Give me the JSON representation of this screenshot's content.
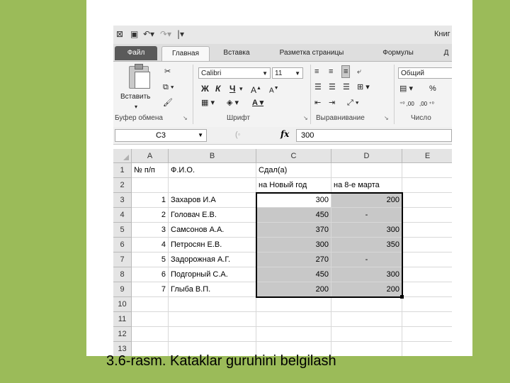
{
  "window": {
    "title": "Книг"
  },
  "tabs": [
    {
      "label": "Файл"
    },
    {
      "label": "Главная"
    },
    {
      "label": "Вставка"
    },
    {
      "label": "Разметка страницы"
    },
    {
      "label": "Формулы"
    },
    {
      "label": "Д"
    }
  ],
  "ribbon": {
    "clipboard": {
      "paste_label": "Вставить",
      "group_label": "Буфер обмена"
    },
    "font": {
      "name": "Calibri",
      "size": "11",
      "group_label": "Шрифт",
      "bold": "Ж",
      "italic": "К",
      "underline": "Ч"
    },
    "alignment": {
      "group_label": "Выравнивание"
    },
    "number": {
      "format": "Общий",
      "group_label": "Число",
      "percent": "%"
    }
  },
  "formula_bar": {
    "name_box": "C3",
    "fx": "fx",
    "value": "300"
  },
  "sheet": {
    "columns": [
      "A",
      "B",
      "C",
      "D",
      "E"
    ],
    "rows": [
      {
        "n": "1",
        "a": "№ п/п",
        "b": "Ф.И.О.",
        "c": "Сдал(а)",
        "d": ""
      },
      {
        "n": "2",
        "a": "",
        "b": "",
        "c": "на Новый год",
        "d": "на 8-е марта"
      },
      {
        "n": "3",
        "a": "1",
        "b": "Захаров И.А",
        "c": "300",
        "d": "200"
      },
      {
        "n": "4",
        "a": "2",
        "b": "Головач Е.В.",
        "c": "450",
        "d": "-"
      },
      {
        "n": "5",
        "a": "3",
        "b": "Самсонов А.А.",
        "c": "370",
        "d": "300"
      },
      {
        "n": "6",
        "a": "4",
        "b": "Петросян Е.В.",
        "c": "300",
        "d": "350"
      },
      {
        "n": "7",
        "a": "5",
        "b": "Задорожная А.Г.",
        "c": "270",
        "d": "-"
      },
      {
        "n": "8",
        "a": "6",
        "b": "Подгорный С.А.",
        "c": "450",
        "d": "300"
      },
      {
        "n": "9",
        "a": "7",
        "b": "Глыба В.П.",
        "c": "200",
        "d": "200"
      },
      {
        "n": "10",
        "a": "",
        "b": "",
        "c": "",
        "d": ""
      },
      {
        "n": "11",
        "a": "",
        "b": "",
        "c": "",
        "d": ""
      },
      {
        "n": "12",
        "a": "",
        "b": "",
        "c": "",
        "d": ""
      },
      {
        "n": "13",
        "a": "",
        "b": "",
        "c": "",
        "d": ""
      }
    ]
  },
  "caption": "3.6-rasm.  Kataklar guruhini belgilash"
}
